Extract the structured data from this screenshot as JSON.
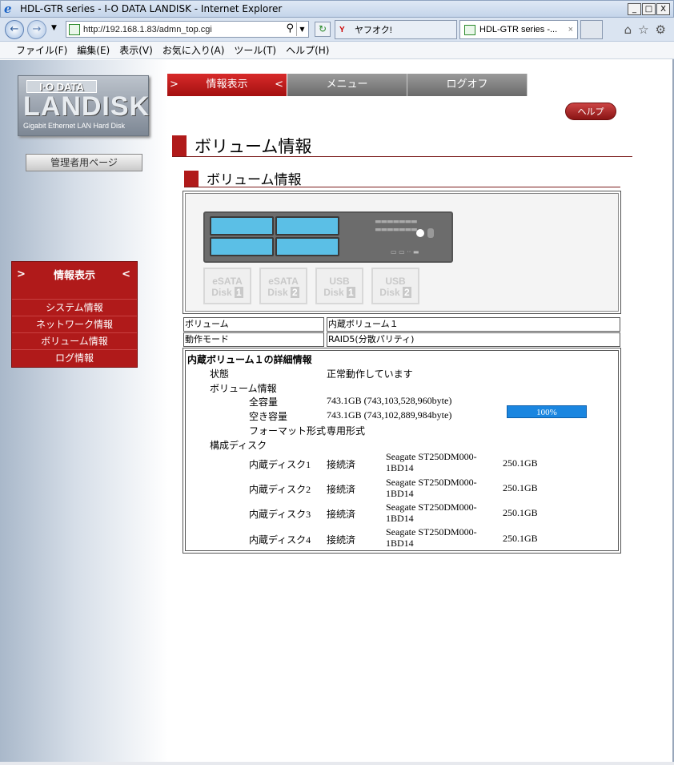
{
  "window": {
    "title": "HDL-GTR series - I-O DATA LANDISK - Internet Explorer",
    "min": "_",
    "max": "□",
    "close": "X"
  },
  "browser": {
    "url": "http://192.168.1.83/admn_top.cgi",
    "tab1": "ヤフオク!",
    "tab2": "HDL-GTR series -...",
    "tab2_close": "×",
    "home_icon": "⌂",
    "star_icon": "☆",
    "gear_icon": "⚙"
  },
  "menubar": [
    "ファイル(F)",
    "編集(E)",
    "表示(V)",
    "お気に入り(A)",
    "ツール(T)",
    "ヘルプ(H)"
  ],
  "logo": {
    "line1": "I·O DATA",
    "line2": "LANDISK",
    "line3": "Gigabit Ethernet LAN Hard Disk"
  },
  "sidebar": {
    "admin_page": "管理者用ページ",
    "menu_title": "情報表示",
    "arrow_left": ">",
    "arrow_right": "<",
    "items": [
      "システム情報",
      "ネットワーク情報",
      "ボリューム情報",
      "ログ情報"
    ]
  },
  "topnav": {
    "info": "情報表示",
    "menu": "メニュー",
    "logoff": "ログオフ",
    "arrow_left": ">",
    "arrow_right": "<"
  },
  "help": "ヘルプ",
  "page": {
    "title": "ボリューム情報",
    "subtitle": "ボリューム情報"
  },
  "device_icons": [
    {
      "l1": "eSATA",
      "l2": "Disk",
      "n": "1"
    },
    {
      "l1": "eSATA",
      "l2": "Disk",
      "n": "2"
    },
    {
      "l1": "USB",
      "l2": "Disk",
      "n": "1"
    },
    {
      "l1": "USB",
      "l2": "Disk",
      "n": "2"
    }
  ],
  "summary": {
    "volume_label": "ボリューム",
    "volume_value": "内蔵ボリューム１",
    "mode_label": "動作モード",
    "mode_value": "RAID5(分散パリティ)"
  },
  "detail": {
    "title": "内蔵ボリューム１の詳細情報",
    "state_label": "状態",
    "state_value": "正常動作しています",
    "volinfo_label": "ボリューム情報",
    "total_label": "全容量",
    "total_value": "743.1GB (743,103,528,960byte)",
    "free_label": "空き容量",
    "free_value": "743.1GB (743,102,889,984byte)",
    "free_percent": "100%",
    "format_label": "フォーマット形式",
    "format_value": "専用形式",
    "disks_label": "構成ディスク",
    "disks": [
      {
        "name": "内蔵ディスク1",
        "status": "接続済",
        "model1": "Seagate ST250DM000-",
        "model2": "1BD14",
        "size": "250.1GB"
      },
      {
        "name": "内蔵ディスク2",
        "status": "接続済",
        "model1": "Seagate ST250DM000-",
        "model2": "1BD14",
        "size": "250.1GB"
      },
      {
        "name": "内蔵ディスク3",
        "status": "接続済",
        "model1": "Seagate ST250DM000-",
        "model2": "1BD14",
        "size": "250.1GB"
      },
      {
        "name": "内蔵ディスク4",
        "status": "接続済",
        "model1": "Seagate ST250DM000-",
        "model2": "1BD14",
        "size": "250.1GB"
      }
    ]
  },
  "colors": {
    "accent": "#b01a1a",
    "progress": "#1a86e0",
    "bay": "#5bbfe6"
  }
}
